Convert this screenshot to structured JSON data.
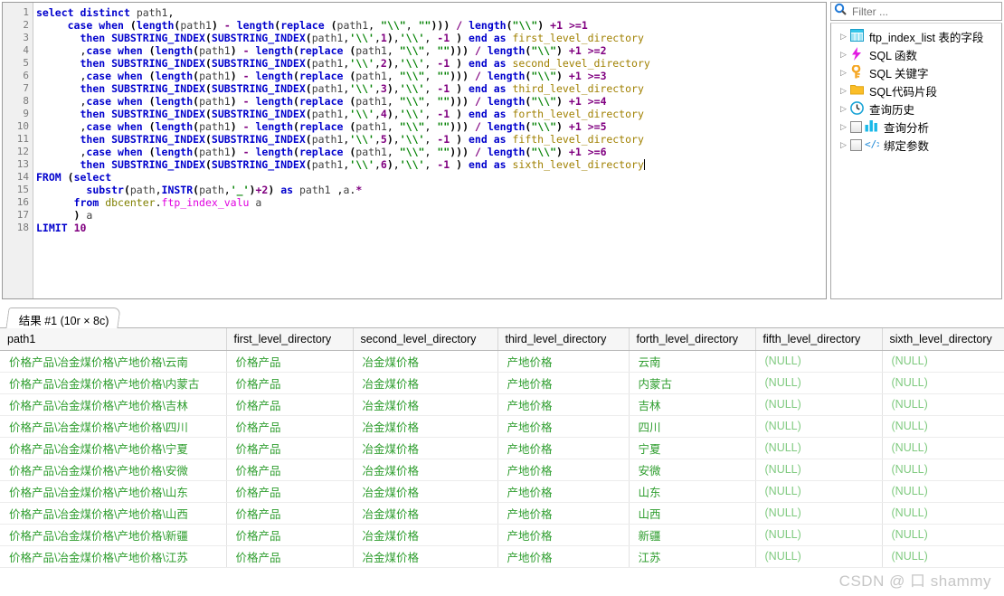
{
  "editor": {
    "line_numbers": [
      "1",
      "2",
      "3",
      "4",
      "5",
      "6",
      "7",
      "8",
      "9",
      "10",
      "11",
      "12",
      "13",
      "14",
      "15",
      "16",
      "17",
      "18"
    ],
    "lines": [
      "select distinct path1,",
      "     case when (length(path1) - length(replace (path1, \"\\\\\", \"\"))) / length(\"\\\\\") +1 >=1",
      "       then SUBSTRING_INDEX(SUBSTRING_INDEX(path1,'\\\\',1),'\\\\', -1 ) end as first_level_directory",
      "       ,case when (length(path1) - length(replace (path1, \"\\\\\", \"\"))) / length(\"\\\\\") +1 >=2",
      "       then SUBSTRING_INDEX(SUBSTRING_INDEX(path1,'\\\\',2),'\\\\', -1 ) end as second_level_directory",
      "       ,case when (length(path1) - length(replace (path1, \"\\\\\", \"\"))) / length(\"\\\\\") +1 >=3",
      "       then SUBSTRING_INDEX(SUBSTRING_INDEX(path1,'\\\\',3),'\\\\', -1 ) end as third_level_directory",
      "       ,case when (length(path1) - length(replace (path1, \"\\\\\", \"\"))) / length(\"\\\\\") +1 >=4",
      "       then SUBSTRING_INDEX(SUBSTRING_INDEX(path1,'\\\\',4),'\\\\', -1 ) end as forth_level_directory",
      "       ,case when (length(path1) - length(replace (path1, \"\\\\\", \"\"))) / length(\"\\\\\") +1 >=5",
      "       then SUBSTRING_INDEX(SUBSTRING_INDEX(path1,'\\\\',5),'\\\\', -1 ) end as fifth_level_directory",
      "       ,case when (length(path1) - length(replace (path1, \"\\\\\", \"\"))) / length(\"\\\\\") +1 >=6",
      "       then SUBSTRING_INDEX(SUBSTRING_INDEX(path1,'\\\\',6),'\\\\', -1 ) end as sixth_level_directory",
      "FROM (select",
      "        substr(path,INSTR(path,'_')+2) as path1 ,a.*",
      "      from dbcenter.ftp_index_valu a",
      "      ) a",
      "LIMIT 10"
    ]
  },
  "right_panel": {
    "filter_placeholder": "Filter ...",
    "filter_value": "",
    "search_icon": "magnifier-icon",
    "tree_items": [
      {
        "label": "ftp_index_list 表的字段",
        "icon": "table-columns-icon",
        "has_checkbox": false
      },
      {
        "label": "SQL 函数",
        "icon": "lightning-icon",
        "has_checkbox": false
      },
      {
        "label": "SQL 关键字",
        "icon": "key-icon",
        "has_checkbox": false
      },
      {
        "label": "SQL代码片段",
        "icon": "folder-icon",
        "has_checkbox": false
      },
      {
        "label": "查询历史",
        "icon": "clock-icon",
        "has_checkbox": false
      },
      {
        "label": "查询分析",
        "icon": "bar-chart-icon",
        "has_checkbox": true
      },
      {
        "label": "绑定参数",
        "icon": "code-tag-icon",
        "has_checkbox": true
      }
    ]
  },
  "results": {
    "tab_label": "结果 #1 (10r × 8c)",
    "columns": [
      "path1",
      "first_level_directory",
      "second_level_directory",
      "third_level_directory",
      "forth_level_directory",
      "fifth_level_directory",
      "sixth_level_directory"
    ],
    "null_text": "(NULL)",
    "rows": [
      [
        "价格产品\\冶金煤价格\\产地价格\\云南",
        "价格产品",
        "冶金煤价格",
        "产地价格",
        "云南",
        "(NULL)",
        "(NULL)"
      ],
      [
        "价格产品\\冶金煤价格\\产地价格\\内蒙古",
        "价格产品",
        "冶金煤价格",
        "产地价格",
        "内蒙古",
        "(NULL)",
        "(NULL)"
      ],
      [
        "价格产品\\冶金煤价格\\产地价格\\吉林",
        "价格产品",
        "冶金煤价格",
        "产地价格",
        "吉林",
        "(NULL)",
        "(NULL)"
      ],
      [
        "价格产品\\冶金煤价格\\产地价格\\四川",
        "价格产品",
        "冶金煤价格",
        "产地价格",
        "四川",
        "(NULL)",
        "(NULL)"
      ],
      [
        "价格产品\\冶金煤价格\\产地价格\\宁夏",
        "价格产品",
        "冶金煤价格",
        "产地价格",
        "宁夏",
        "(NULL)",
        "(NULL)"
      ],
      [
        "价格产品\\冶金煤价格\\产地价格\\安微",
        "价格产品",
        "冶金煤价格",
        "产地价格",
        "安微",
        "(NULL)",
        "(NULL)"
      ],
      [
        "价格产品\\冶金煤价格\\产地价格\\山东",
        "价格产品",
        "冶金煤价格",
        "产地价格",
        "山东",
        "(NULL)",
        "(NULL)"
      ],
      [
        "价格产品\\冶金煤价格\\产地价格\\山西",
        "价格产品",
        "冶金煤价格",
        "产地价格",
        "山西",
        "(NULL)",
        "(NULL)"
      ],
      [
        "价格产品\\冶金煤价格\\产地价格\\新疆",
        "价格产品",
        "冶金煤价格",
        "产地价格",
        "新疆",
        "(NULL)",
        "(NULL)"
      ],
      [
        "价格产品\\冶金煤价格\\产地价格\\江苏",
        "价格产品",
        "冶金煤价格",
        "产地价格",
        "江苏",
        "(NULL)",
        "(NULL)"
      ]
    ]
  },
  "watermark": "CSDN @ 口 shammy",
  "colors": {
    "keyword": "#0000cd",
    "string": "#008000",
    "number": "#800080",
    "identifier": "#808000",
    "table": "#e000e0",
    "cell_text": "#2f9e2f",
    "null_text": "#7fca7f",
    "watermark": "#c6c6c6"
  }
}
